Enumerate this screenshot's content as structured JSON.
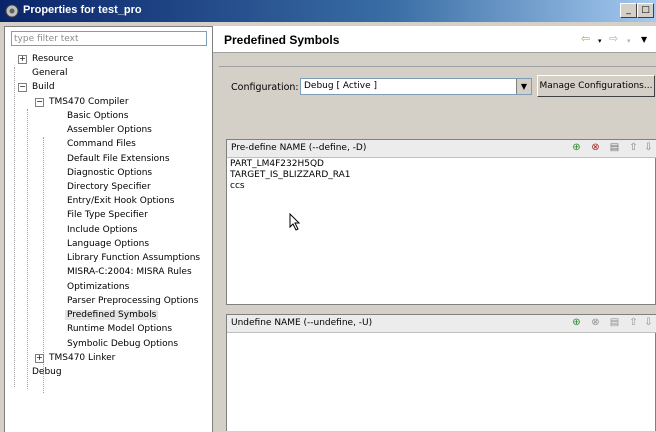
{
  "window": {
    "title": "Properties for test_pro",
    "min_label": "_",
    "max_label": "□"
  },
  "filter": {
    "placeholder": "type filter text"
  },
  "tree": [
    {
      "label": "Resource",
      "expander": "+"
    },
    {
      "label": "General"
    },
    {
      "label": "Build",
      "expander": "−"
    },
    {
      "label": "TMS470 Compiler",
      "expander": "−"
    },
    {
      "label": "Basic Options"
    },
    {
      "label": "Assembler Options"
    },
    {
      "label": "Command Files"
    },
    {
      "label": "Default File Extensions"
    },
    {
      "label": "Diagnostic Options"
    },
    {
      "label": "Directory Specifier"
    },
    {
      "label": "Entry/Exit Hook Options"
    },
    {
      "label": "File Type Specifier"
    },
    {
      "label": "Include Options"
    },
    {
      "label": "Language Options"
    },
    {
      "label": "Library Function Assumptions"
    },
    {
      "label": "MISRA-C:2004: MISRA Rules"
    },
    {
      "label": "Optimizations"
    },
    {
      "label": "Parser Preprocessing Options"
    },
    {
      "label": "Predefined Symbols",
      "selected": true
    },
    {
      "label": "Runtime Model Options"
    },
    {
      "label": "Symbolic Debug Options"
    },
    {
      "label": "TMS470 Linker",
      "expander": "+"
    },
    {
      "label": "Debug"
    }
  ],
  "page": {
    "title": "Predefined Symbols"
  },
  "configuration": {
    "label": "Configuration:",
    "value": "Debug  [ Active ]",
    "manage_button": "Manage Configurations..."
  },
  "predefine": {
    "label": "Pre-define NAME (--define, -D)",
    "items": [
      "PART_LM4F232H5QD",
      "TARGET_IS_BLIZZARD_RA1",
      "ccs"
    ]
  },
  "undefine": {
    "label": "Undefine NAME (--undefine, -U)",
    "items": []
  },
  "colors": {
    "title_start": "#0a246a",
    "title_end": "#a6caf0",
    "selection": "#e4e4e4"
  }
}
